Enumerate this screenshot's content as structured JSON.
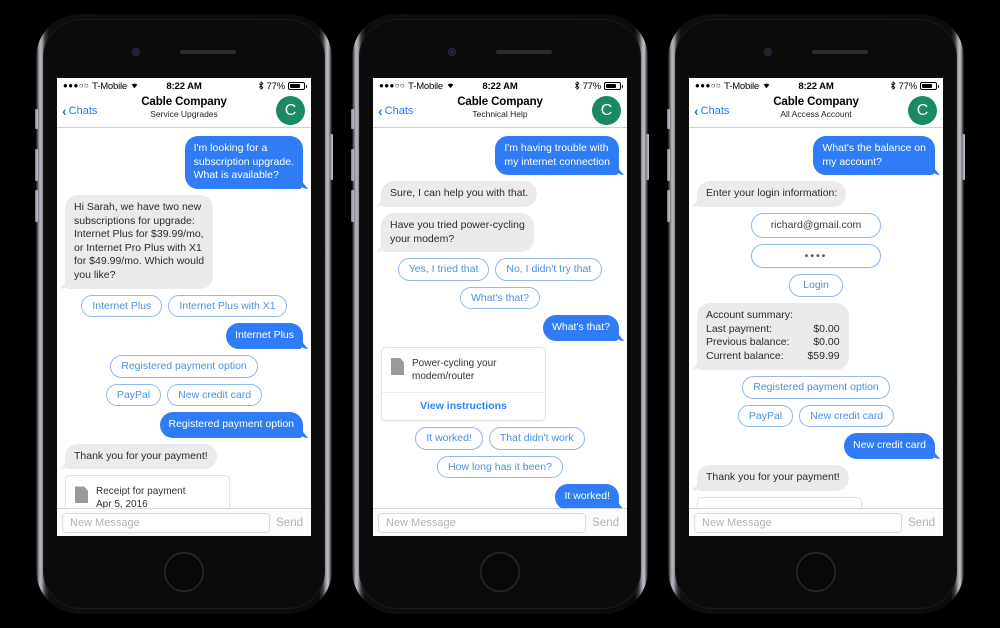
{
  "status_bar": {
    "signal_dots": "●●●○○",
    "carrier": "T-Mobile",
    "wifi_icon": "wifi-icon",
    "time": "8:22 AM",
    "bluetooth_icon": "bluetooth-icon",
    "battery_percent": "77%"
  },
  "composer": {
    "placeholder": "New Message",
    "send_label": "Send"
  },
  "colors": {
    "outgoing_bubble": "#2f7cf6",
    "incoming_bubble": "#ebebeb",
    "link_blue": "#1c7cf2",
    "chip_border": "#8fb8f0",
    "avatar_green": "#1a8a66"
  },
  "phones": [
    {
      "nav": {
        "back_label": "Chats",
        "title": "Cable Company",
        "subtitle": "Service Upgrades",
        "avatar_letter": "C"
      },
      "messages": [
        {
          "kind": "bubble",
          "side": "out",
          "text": "I'm looking for a\nsubscription upgrade.\nWhat is available?"
        },
        {
          "kind": "bubble",
          "side": "in",
          "text": "Hi Sarah, we have two new\nsubscriptions for upgrade:\nInternet Plus for $39.99/mo,\nor Internet Pro Plus with X1\nfor $49.99/mo. Which would\nyou like?"
        },
        {
          "kind": "chips",
          "align": "center",
          "items": [
            "Internet Plus",
            "Internet Plus with X1"
          ]
        },
        {
          "kind": "bubble",
          "side": "out",
          "text": "Internet Plus"
        },
        {
          "kind": "chips",
          "align": "center",
          "items": [
            "Registered payment option"
          ]
        },
        {
          "kind": "chips",
          "align": "center",
          "items": [
            "PayPal",
            "New credit card"
          ]
        },
        {
          "kind": "bubble",
          "side": "out",
          "text": "Registered payment option"
        },
        {
          "kind": "bubble",
          "side": "in",
          "text": "Thank you for your payment!"
        },
        {
          "kind": "filecard",
          "title": "Receipt for payment",
          "subtitle": "Apr 5, 2016",
          "icon": "document-icon"
        }
      ]
    },
    {
      "nav": {
        "back_label": "Chats",
        "title": "Cable Company",
        "subtitle": "Technical Help",
        "avatar_letter": "C"
      },
      "messages": [
        {
          "kind": "bubble",
          "side": "out",
          "text": "I'm having trouble with\nmy internet connection"
        },
        {
          "kind": "bubble",
          "side": "in",
          "text": "Sure, I can help you with that."
        },
        {
          "kind": "bubble",
          "side": "in",
          "text": "Have you tried power-cycling\nyour modem?"
        },
        {
          "kind": "chips",
          "align": "center",
          "items": [
            "Yes, I tried that",
            "No, I didn't try that"
          ]
        },
        {
          "kind": "chips",
          "align": "center",
          "items": [
            "What's that?"
          ]
        },
        {
          "kind": "bubble",
          "side": "out",
          "text": "What's that?"
        },
        {
          "kind": "filecard",
          "title": "Power-cycling your",
          "subtitle": "modem/router",
          "icon": "document-icon",
          "action": "View instructions"
        },
        {
          "kind": "chips",
          "align": "center",
          "items": [
            "It worked!",
            "That didn't work"
          ]
        },
        {
          "kind": "chips",
          "align": "center",
          "items": [
            "How long has it been?"
          ]
        },
        {
          "kind": "bubble",
          "side": "out",
          "text": "It worked!"
        }
      ]
    },
    {
      "nav": {
        "back_label": "Chats",
        "title": "Cable Company",
        "subtitle": "All Access Account",
        "avatar_letter": "C"
      },
      "messages": [
        {
          "kind": "bubble",
          "side": "out",
          "text": "What's the balance on\nmy account?"
        },
        {
          "kind": "bubble",
          "side": "in",
          "text": "Enter your login information:"
        },
        {
          "kind": "inputchip",
          "align": "center",
          "value": "richard@gmail.com"
        },
        {
          "kind": "inputchip",
          "align": "center",
          "value": "••••",
          "masked": true
        },
        {
          "kind": "chips",
          "align": "center",
          "items": [
            "Login"
          ]
        },
        {
          "kind": "summary",
          "side": "in",
          "heading": "Account summary:",
          "rows": [
            {
              "label": "Last payment:",
              "value": "$0.00"
            },
            {
              "label": "Previous balance:",
              "value": "$0.00"
            },
            {
              "label": "Current balance:",
              "value": "$59.99"
            }
          ]
        },
        {
          "kind": "chips",
          "align": "center",
          "items": [
            "Registered payment option"
          ]
        },
        {
          "kind": "chips",
          "align": "center",
          "items": [
            "PayPal",
            "New credit card"
          ]
        },
        {
          "kind": "bubble",
          "side": "out",
          "text": "New credit card"
        },
        {
          "kind": "bubble",
          "side": "in",
          "text": "Thank you for your payment!"
        },
        {
          "kind": "filecard",
          "title": "",
          "subtitle": "",
          "icon": "document-icon"
        }
      ]
    }
  ]
}
